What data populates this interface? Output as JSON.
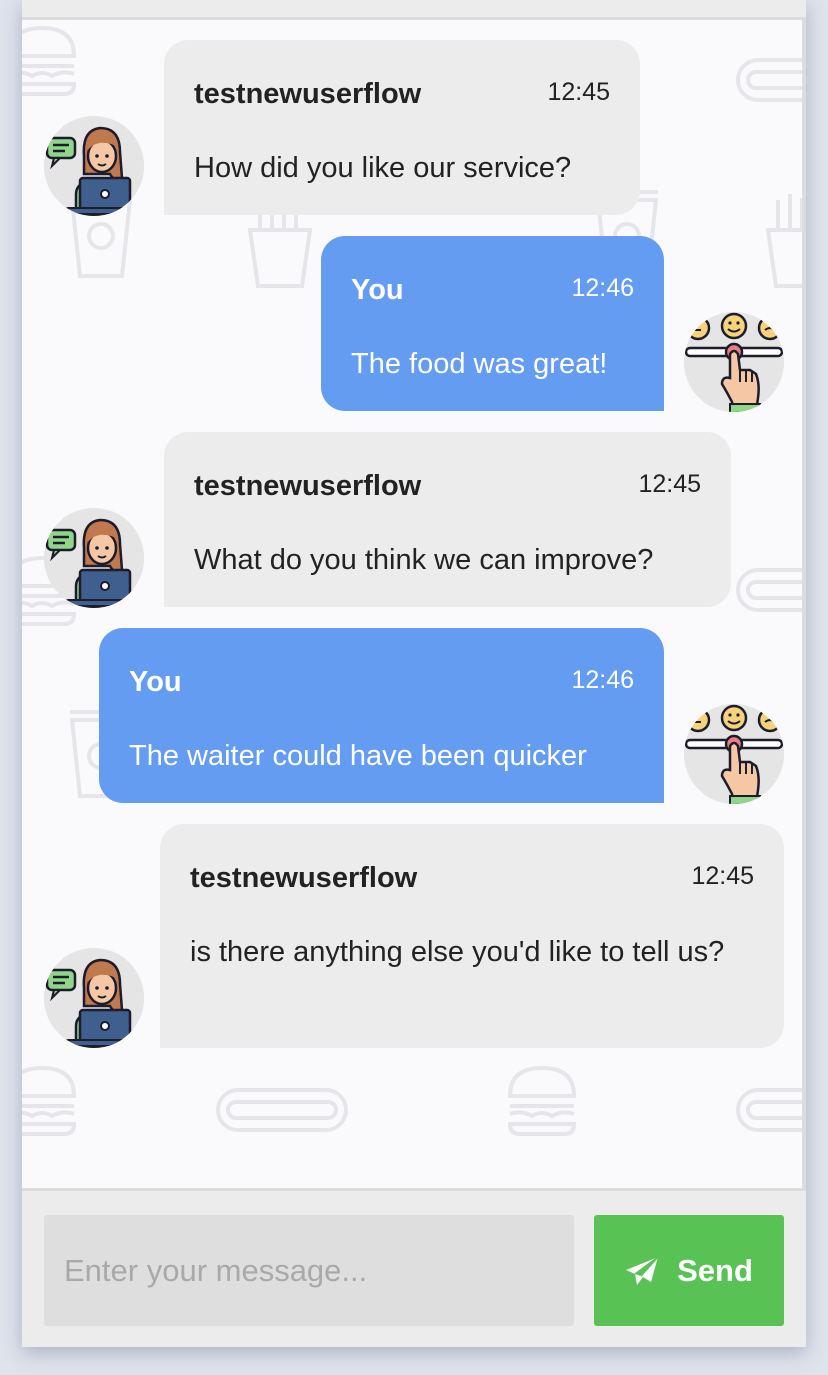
{
  "messages": [
    {
      "sender": "testnewuserflow",
      "time": "12:45",
      "text": "How did you like our service?",
      "side": "them"
    },
    {
      "sender": "You",
      "time": "12:46",
      "text": "The food was great!",
      "side": "me"
    },
    {
      "sender": "testnewuserflow",
      "time": "12:45",
      "text": "What do you think we can improve?",
      "side": "them"
    },
    {
      "sender": "You",
      "time": "12:46",
      "text": "The waiter could have been quicker",
      "side": "me"
    },
    {
      "sender": "testnewuserflow",
      "time": "12:45",
      "text": "is there anything else you'd like to tell us?",
      "side": "them"
    }
  ],
  "composer": {
    "placeholder": "Enter your message...",
    "send_label": "Send",
    "send_icon": "paper-plane-icon"
  },
  "colors": {
    "incoming_bubble": "#ececec",
    "outgoing_bubble": "#639cf1",
    "send_button": "#58c254"
  },
  "icons": {
    "agent_avatar": "support-agent-avatar",
    "user_avatar": "rating-feedback-avatar"
  }
}
